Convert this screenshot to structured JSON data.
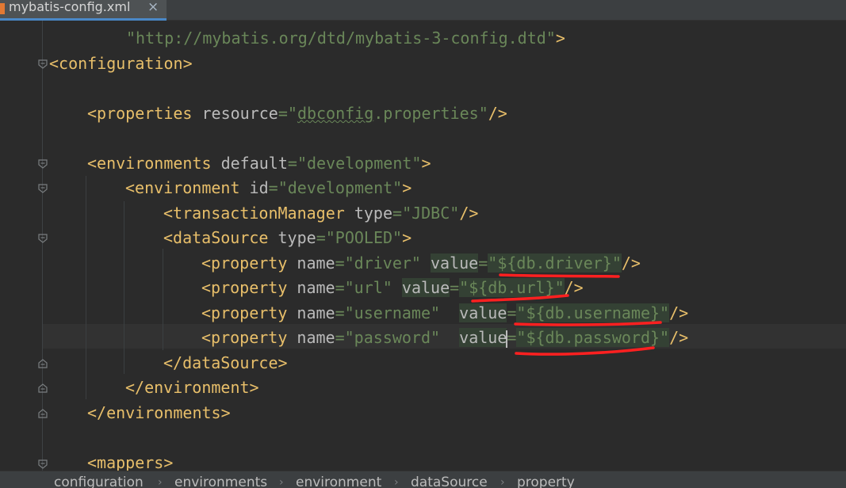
{
  "tab": {
    "file_name": "mybatis-config.xml",
    "close_glyph": "×",
    "icon": "xml-file-icon",
    "active_color": "#4a88c7"
  },
  "editor": {
    "colors": {
      "background": "#2b2b2b",
      "tag": "#e8bf6a",
      "attribute": "#bababa",
      "string": "#6a8759",
      "annotation": "#ff2020"
    },
    "lines": {
      "dtd": {
        "url": "\"http://mybatis.org/dtd/mybatis-3-config.dtd\"",
        "close": ">"
      },
      "configuration": {
        "open": "<",
        "name": "configuration",
        "close": ">"
      },
      "properties": {
        "open": "<",
        "name": "properties",
        "attr": "resource",
        "eq": "=",
        "q1": "\"",
        "value_typo": "dbconfig",
        "value_rest": ".properties",
        "q2": "\"",
        "close": "/>"
      },
      "environments": {
        "open": "<",
        "name": "environments",
        "attr": "default",
        "eq": "=",
        "value": "\"development\"",
        "close": ">"
      },
      "environment": {
        "open": "<",
        "name": "environment",
        "attr": "id",
        "eq": "=",
        "value": "\"development\"",
        "close": ">"
      },
      "transaction": {
        "open": "<",
        "name": "transactionManager",
        "attr": "type",
        "eq": "=",
        "value": "\"JDBC\"",
        "close": "/>"
      },
      "datasource": {
        "open": "<",
        "name": "dataSource",
        "attr": "type",
        "eq": "=",
        "value": "\"POOLED\"",
        "close": ">"
      },
      "prop_driver": {
        "open": "<",
        "name": "property",
        "attr1": "name",
        "eq1": "=",
        "val1": "\"driver\"",
        "attr2": "value",
        "eq2": "=",
        "val2": "\"${db.driver}\"",
        "close": "/>"
      },
      "prop_url": {
        "open": "<",
        "name": "property",
        "attr1": "name",
        "eq1": "=",
        "val1": "\"url\"",
        "attr2": "value",
        "eq2": "=",
        "val2": "\"${db.url}\"",
        "close": "/>"
      },
      "prop_username": {
        "open": "<",
        "name": "property",
        "attr1": "name",
        "eq1": "=",
        "val1": "\"username\"",
        "attr2": "value",
        "eq2": "=",
        "val2": "\"${db.username}\"",
        "close": "/>"
      },
      "prop_password": {
        "open": "<",
        "name": "property",
        "attr1": "name",
        "eq1": "=",
        "val1": "\"password\"",
        "attr2a": "val",
        "attr2b": "ue",
        "eq2": "=",
        "val2": "\"${db.password}\"",
        "close": "/>"
      },
      "datasource_end": {
        "open": "</",
        "name": "dataSource",
        "close": ">"
      },
      "environment_end": {
        "open": "</",
        "name": "environment",
        "close": ">"
      },
      "environments_end": {
        "open": "</",
        "name": "environments",
        "close": ">"
      },
      "mappers": {
        "open": "<",
        "name": "mappers",
        "close": ">"
      }
    }
  },
  "breadcrumb": {
    "items": [
      "configuration",
      "environments",
      "environment",
      "dataSource",
      "property"
    ],
    "separator": "›"
  }
}
